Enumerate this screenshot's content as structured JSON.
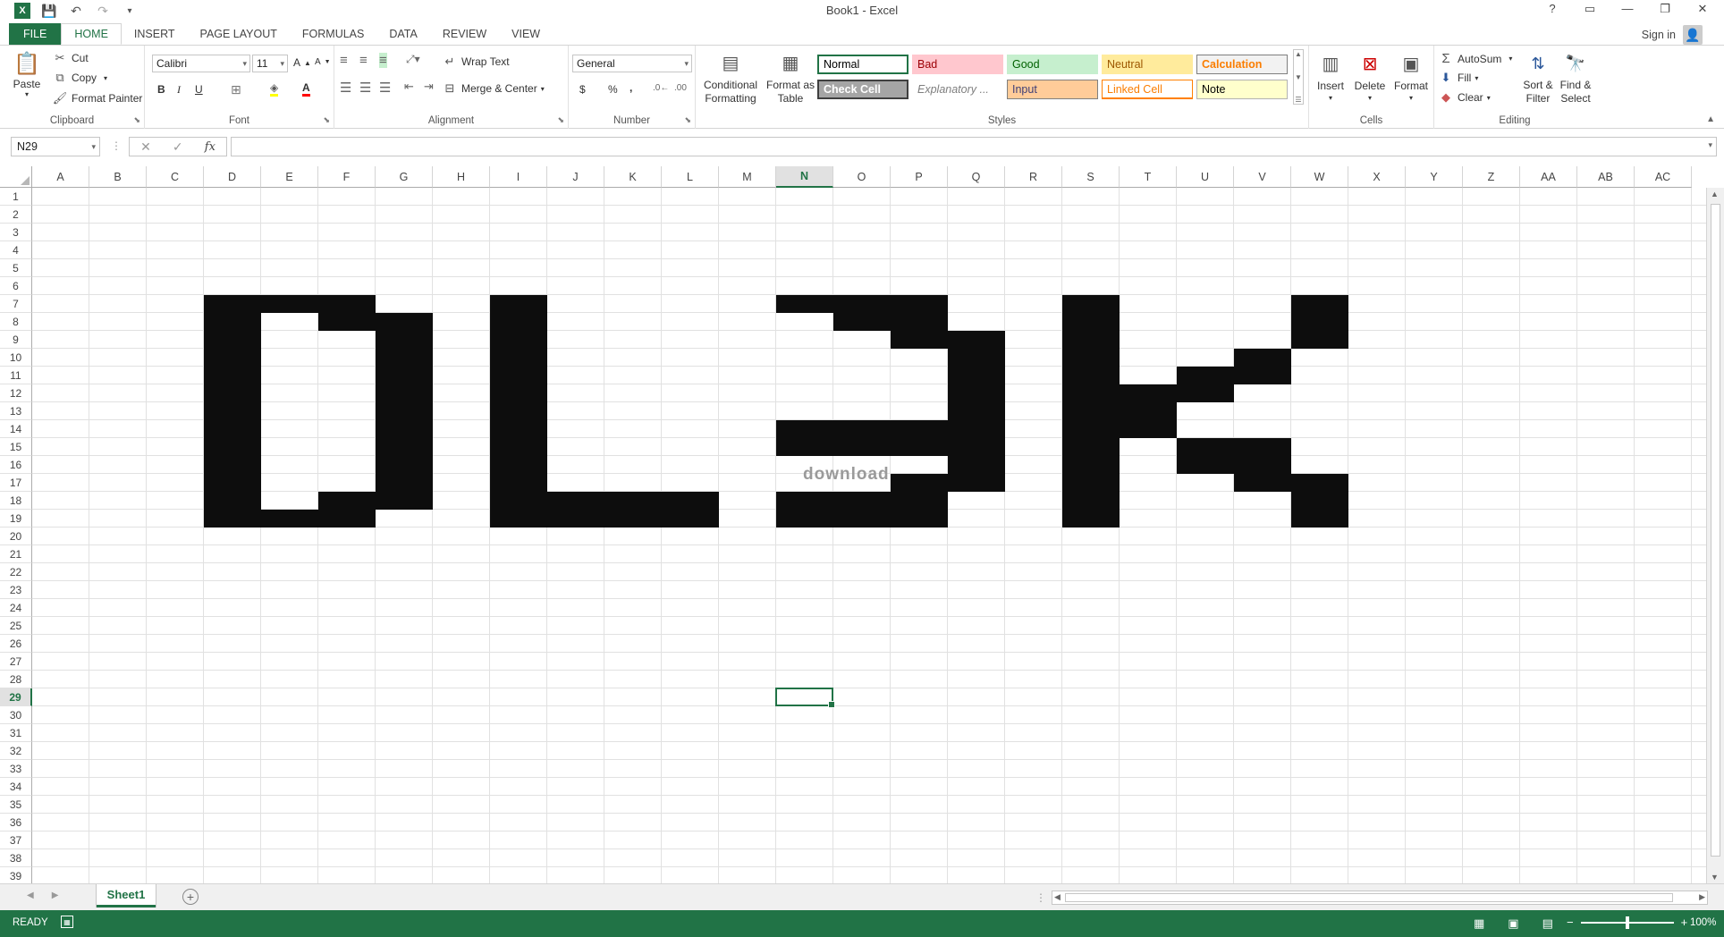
{
  "window": {
    "title": "Book1 - Excel",
    "signin": "Sign in"
  },
  "tabs": [
    "FILE",
    "HOME",
    "INSERT",
    "PAGE LAYOUT",
    "FORMULAS",
    "DATA",
    "REVIEW",
    "VIEW"
  ],
  "active_tab": "HOME",
  "ribbon": {
    "clipboard": {
      "label": "Clipboard",
      "paste": "Paste",
      "cut": "Cut",
      "copy": "Copy",
      "format_painter": "Format Painter"
    },
    "font": {
      "label": "Font",
      "family": "Calibri",
      "size": "11",
      "bold": "B",
      "italic": "I",
      "underline": "U"
    },
    "alignment": {
      "label": "Alignment",
      "wrap_text": "Wrap Text",
      "merge_center": "Merge & Center"
    },
    "number": {
      "label": "Number",
      "format": "General",
      "currency": "$",
      "percent": "%",
      "comma": ","
    },
    "styles": {
      "label": "Styles",
      "conditional_formatting": "Conditional Formatting",
      "format_as_table": "Format as Table",
      "cells": [
        {
          "name": "Normal",
          "bg": "#ffffff",
          "fg": "#000000",
          "border": "#217346"
        },
        {
          "name": "Bad",
          "bg": "#ffc7ce",
          "fg": "#9c0006",
          "border": "#ffc7ce"
        },
        {
          "name": "Good",
          "bg": "#c6efce",
          "fg": "#006100",
          "border": "#c6efce"
        },
        {
          "name": "Neutral",
          "bg": "#ffeb9c",
          "fg": "#9c5700",
          "border": "#ffeb9c"
        },
        {
          "name": "Calculation",
          "bg": "#f2f2f2",
          "fg": "#fa7d00",
          "border": "#7f7f7f"
        },
        {
          "name": "Check Cell",
          "bg": "#a5a5a5",
          "fg": "#ffffff",
          "border": "#3f3f3f"
        },
        {
          "name": "Explanatory ...",
          "bg": "#ffffff",
          "fg": "#7f7f7f",
          "border": "#ffffff"
        },
        {
          "name": "Input",
          "bg": "#ffcc99",
          "fg": "#3f3f76",
          "border": "#7f7f7f"
        },
        {
          "name": "Linked Cell",
          "bg": "#ffffff",
          "fg": "#fa7d00",
          "border": "#ff8001"
        },
        {
          "name": "Note",
          "bg": "#ffffcc",
          "fg": "#000000",
          "border": "#b2b2b2"
        }
      ]
    },
    "cells": {
      "label": "Cells",
      "insert": "Insert",
      "delete": "Delete",
      "format": "Format"
    },
    "editing": {
      "label": "Editing",
      "autosum": "AutoSum",
      "fill": "Fill",
      "clear": "Clear",
      "sort_filter": "Sort & Filter",
      "find_select": "Find & Select"
    }
  },
  "formula_bar": {
    "name_box": "N29",
    "fx": "fx",
    "cancel": "✕",
    "enter": "✓",
    "value": ""
  },
  "grid": {
    "columns": [
      "A",
      "B",
      "C",
      "D",
      "E",
      "F",
      "G",
      "H",
      "I",
      "J",
      "K",
      "L",
      "M",
      "N",
      "O",
      "P",
      "Q",
      "R",
      "S",
      "T",
      "U",
      "V",
      "W",
      "X",
      "Y",
      "Z",
      "AA",
      "AB",
      "AC"
    ],
    "rows": [
      "1",
      "2",
      "3",
      "4",
      "5",
      "6",
      "7",
      "8",
      "9",
      "10",
      "11",
      "12",
      "13",
      "14",
      "15",
      "16",
      "17",
      "18",
      "19",
      "20",
      "21",
      "22",
      "23",
      "24",
      "25",
      "26",
      "27",
      "28",
      "29",
      "30",
      "31",
      "32",
      "33",
      "34",
      "35",
      "36",
      "37",
      "38",
      "39"
    ],
    "selected_column": "N",
    "selected_row": "29",
    "selected_cell": "N29",
    "filled_color": "#0d0d0d",
    "filled_ranges": [
      "D7:D19",
      "E7:E7",
      "E19:E19",
      "F7:F8",
      "F18:F19",
      "G8:G18",
      "I7:I19",
      "J18:L19",
      "N7:N7",
      "N14:N15",
      "N18:N19",
      "O7:O8",
      "O14:O15",
      "O18:O19",
      "P7:P9",
      "P14:P15",
      "P17:P19",
      "Q9:Q17",
      "S7:S19",
      "T12:T14",
      "U11:U12",
      "U15:U16",
      "V10:V11",
      "V15:V17",
      "W7:W9",
      "W17:W19"
    ]
  },
  "watermark": "download",
  "sheet": {
    "tab": "Sheet1",
    "add": "+"
  },
  "status": {
    "ready": "READY",
    "zoom": "100%",
    "zoom_level": 1.0
  }
}
